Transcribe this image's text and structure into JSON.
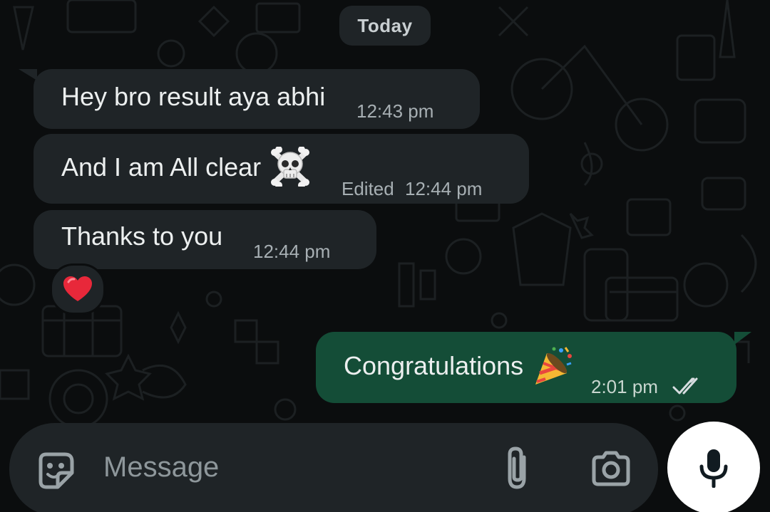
{
  "date_separator": "Today",
  "messages": [
    {
      "direction": "incoming",
      "text": "Hey bro result aya abhi",
      "time": "12:43 pm",
      "edited": ""
    },
    {
      "direction": "incoming",
      "text": "And I am All clear",
      "emoji": "skull-and-crossbones",
      "time": "12:44 pm",
      "edited": "Edited"
    },
    {
      "direction": "incoming",
      "text": "Thanks to you",
      "time": "12:44 pm",
      "edited": "",
      "reaction": "red-heart"
    },
    {
      "direction": "outgoing",
      "text": "Congratulations",
      "emoji": "party-popper",
      "time": "2:01 pm",
      "status": "read-double-check"
    }
  ],
  "composer": {
    "placeholder": "Message",
    "icons": [
      "sticker-icon",
      "attachment-paperclip-icon",
      "camera-icon",
      "microphone-icon"
    ]
  },
  "colors": {
    "background": "#0b0d0e",
    "incoming_bubble": "#1f2427",
    "outgoing_bubble": "#144d37",
    "read_check": "#d7dde0",
    "mic_button": "#ffffff"
  }
}
